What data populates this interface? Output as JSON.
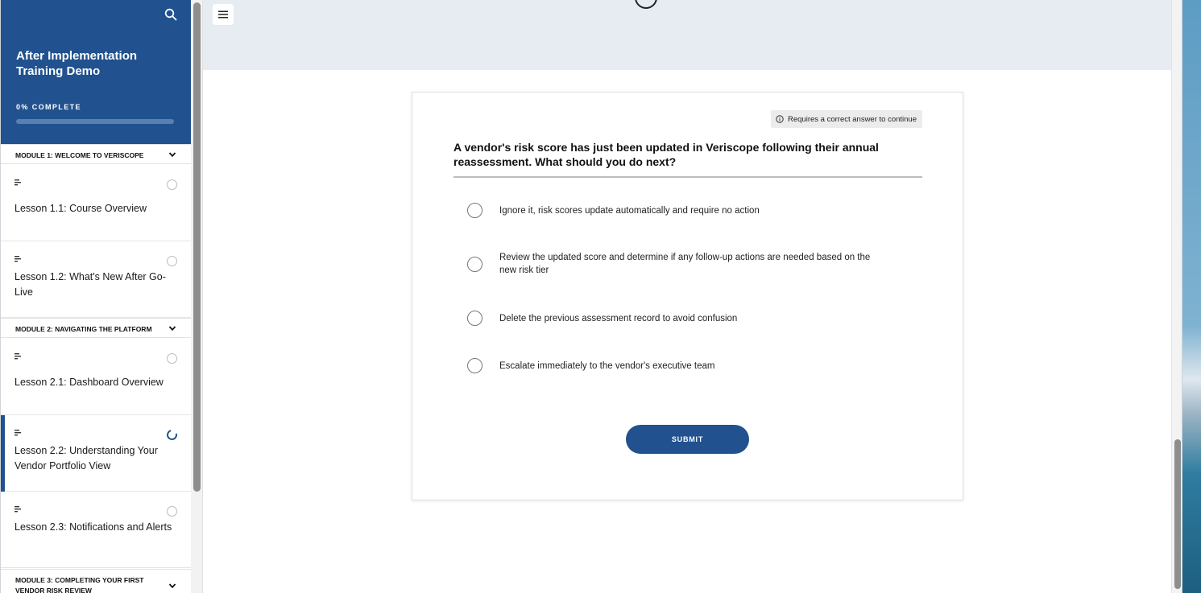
{
  "sidebar": {
    "course_title": "After Implementation Training Demo",
    "progress_label": "0% COMPLETE",
    "progress_value": 0,
    "modules": [
      {
        "title": "MODULE 1: WELCOME TO VERISCOPE"
      },
      {
        "title": "MODULE 2: NAVIGATING THE PLATFORM"
      },
      {
        "title": "MODULE 3: COMPLETING YOUR FIRST VENDOR RISK REVIEW"
      }
    ],
    "lessons": [
      {
        "title": "Lesson 1.1: Course Overview",
        "status": "not-started"
      },
      {
        "title": "Lesson 1.2: What's New After Go-Live",
        "status": "not-started"
      },
      {
        "title": "Lesson 2.1: Dashboard Overview",
        "status": "not-started"
      },
      {
        "title": "Lesson 2.2: Understanding Your Vendor Portfolio View",
        "status": "in-progress"
      },
      {
        "title": "Lesson 2.3: Notifications and Alerts",
        "status": "not-started"
      }
    ]
  },
  "quiz": {
    "requirement": "Requires a correct answer to continue",
    "question": "A vendor's risk score has just been updated in Veriscope following their annual reassessment. What should you do next?",
    "options": [
      "Ignore it, risk scores update automatically and require no action",
      "Review the updated score and determine if any follow-up actions are needed based on the new risk tier",
      "Delete the previous assessment record to avoid confusion",
      "Escalate immediately to the vendor's executive team"
    ],
    "submit_label": "SUBMIT"
  },
  "colors": {
    "brand": "#21528f",
    "header_band": "#e7ecf3"
  },
  "icons": {
    "search": "search-icon",
    "menu": "hamburger-menu-icon",
    "chevron": "chevron-down-icon",
    "lesson": "text-lines-icon",
    "info": "info-icon"
  }
}
